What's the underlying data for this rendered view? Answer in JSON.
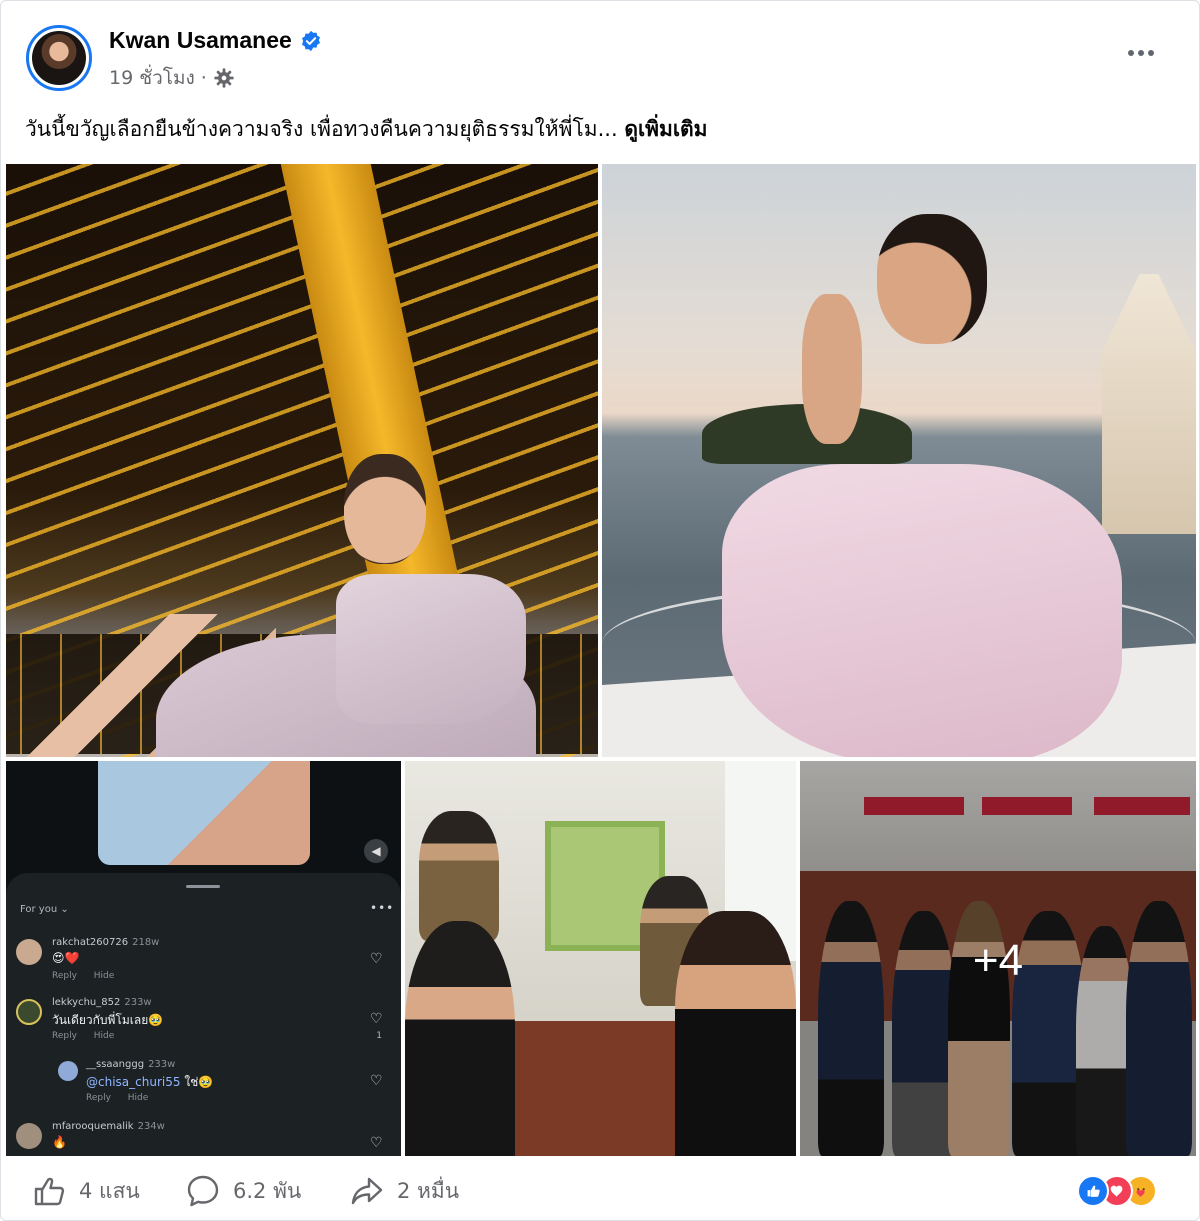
{
  "post": {
    "author_name": "Kwan Usamanee",
    "timestamp": "19 ชั่วโมง",
    "separator": "·",
    "caption_text": "วันนี้ขวัญเลือกยืนข้างความจริง เพื่อทวงคืนความยุติธรรมให้พี่โม...",
    "see_more_label": "ดูเพิ่มเติม",
    "more_photos_label": "+4"
  },
  "embedded_comments": {
    "feed_label": "For you",
    "items": [
      {
        "user": "rakchat260726",
        "time": "218w",
        "text": "😍❤️",
        "actions": "Reply Hide",
        "count": ""
      },
      {
        "user": "lekkychu_852",
        "time": "233w",
        "text": "วันเดียวกับพี่โมเลย🥹",
        "actions": "Reply Hide",
        "count": "1"
      },
      {
        "user": "__ssaanggg",
        "time": "233w",
        "mention": "@chisa_churi55",
        "text": " ใช่🥹",
        "actions": "Reply Hide",
        "count": ""
      },
      {
        "user": "mfarooquemalik",
        "time": "234w",
        "text": "🔥",
        "actions": "",
        "count": ""
      }
    ]
  },
  "footer": {
    "like_count": "4 แสน",
    "comment_count": "6.2 พัน",
    "share_count": "2 หมื่น"
  },
  "icons": {
    "verified": "verified-badge-icon",
    "audience": "gear-icon",
    "more": "more-options-icon",
    "like": "thumbs-up-icon",
    "comment": "comment-bubble-icon",
    "share": "share-arrow-icon",
    "reactions": [
      "like-reaction-icon",
      "love-reaction-icon",
      "care-reaction-icon"
    ]
  },
  "colors": {
    "verified": "#1877f2",
    "secondary_text": "#65676b",
    "like_reaction": "#1877f2",
    "love_reaction": "#f33e58",
    "care_reaction": "#f7b125"
  }
}
